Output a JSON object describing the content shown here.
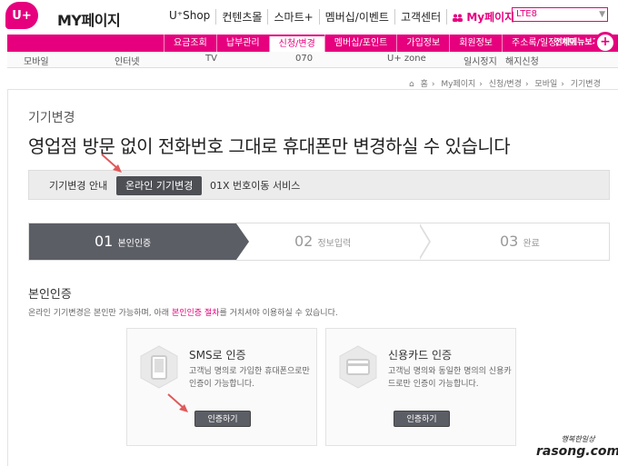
{
  "header": {
    "logo_text": "U+",
    "title": "MY페이지",
    "gnb": [
      "U⁺Shop",
      "컨텐츠몰",
      "스마트+",
      "멤버십/이벤트",
      "고객센터",
      "My페이지"
    ],
    "select_value": "LTE8"
  },
  "menu1": {
    "items": [
      "요금조회",
      "납부관리",
      "신청/변경",
      "멤버십/포인트",
      "가입정보",
      "회원정보",
      "주소록/일정/메모"
    ],
    "all_menu": "전체메뉴보기",
    "plus": "+"
  },
  "menu2": {
    "items": [
      "모바일",
      "인터넷",
      "TV",
      "070",
      "U+ zone",
      "일시정지",
      "해지신청"
    ]
  },
  "breadcrumb": [
    "홈",
    "My페이지",
    "신청/변경",
    "모바일",
    "기기변경"
  ],
  "page": {
    "sub_title": "기기변경",
    "main_title": "영업점 방문 없이 전화번호 그대로 휴대폰만 변경하실 수 있습니다"
  },
  "tabs": [
    "기기변경 안내",
    "온라인 기기변경",
    "01X 번호이동 서비스"
  ],
  "steps": [
    {
      "num": "01",
      "label": "본인인증"
    },
    {
      "num": "02",
      "label": "정보입력"
    },
    {
      "num": "03",
      "label": "완료"
    }
  ],
  "section": {
    "title": "본인인증",
    "desc_pre": "온라인 기기변경은 본인만 가능하며, 아래 ",
    "desc_hl": "본인인증 절차",
    "desc_post": "를 거치셔야 이용하실 수 있습니다."
  },
  "cards": [
    {
      "title": "SMS로 인증",
      "desc": "고객님 명의로 가입한 휴대폰으로만 인증이 가능합니다.",
      "button": "인증하기"
    },
    {
      "title": "신용카드 인증",
      "desc": "고객님 명의와 동일한 명의의 신용카드로만 인증이 가능합니다.",
      "button": "인증하기"
    }
  ],
  "watermark": {
    "top": "행복한일상",
    "bottom": "rasong.com"
  },
  "colors": {
    "brand": "#e6007e",
    "dark": "#5c5e66",
    "arrow": "#e05a5a"
  }
}
